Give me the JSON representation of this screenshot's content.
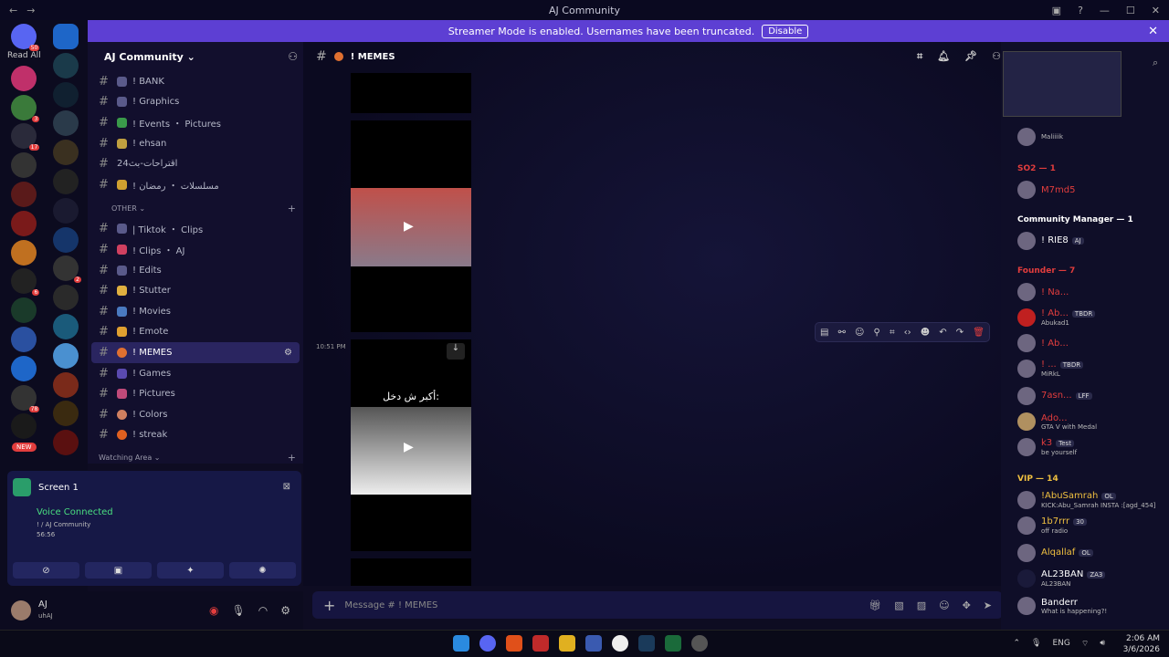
{
  "window": {
    "title": "AJ Community"
  },
  "banner": {
    "text": "Streamer Mode is enabled. Usernames have been truncated.",
    "button": "Disable"
  },
  "rail": {
    "read_all": "Read All",
    "top_badge": "50",
    "new_badge": "NEW",
    "badges": [
      "3",
      "17",
      "6",
      "78",
      "2"
    ]
  },
  "server": {
    "name": "AJ Community ⌄"
  },
  "channels": [
    {
      "name": "! BANK"
    },
    {
      "name": "! Graphics"
    },
    {
      "name": "! Events ・ Pictures"
    },
    {
      "name": "! ehsan"
    },
    {
      "name": "اقتراحات-بث24"
    },
    {
      "name": "! مسلسلات ・ رمضان"
    }
  ],
  "category_other": {
    "name": "OTHER ⌄"
  },
  "channels_other": [
    {
      "name": "| Tiktok ・ Clips"
    },
    {
      "name": "! Clips ・ AJ"
    },
    {
      "name": "! Edits"
    },
    {
      "name": "! Stutter"
    },
    {
      "name": "! Movies"
    },
    {
      "name": "! Emote"
    },
    {
      "name": "! MEMES"
    },
    {
      "name": "! Games"
    },
    {
      "name": "! Pictures"
    },
    {
      "name": "! Colors"
    },
    {
      "name": "! streak"
    }
  ],
  "category_watching": {
    "name": "Watching Area ⌄"
  },
  "voice": {
    "title": "Screen 1",
    "status": "Voice Connected",
    "channel": "! / AJ Community",
    "timer": "56:56"
  },
  "user": {
    "name": "AJ",
    "status": "uhAJ"
  },
  "main": {
    "channel": "! MEMES",
    "time": "10:51 PM",
    "overlay_text": "أكبر ش دخل:"
  },
  "composer": {
    "placeholder": "Message # ! MEMES"
  },
  "members": {
    "groups": [
      {
        "title": "SO2 — 1",
        "color": "#e23d3d"
      },
      {
        "title": "Community Manager — 1",
        "color": "#ffffff"
      },
      {
        "title": "Founder — 7",
        "color": "#e23d3d"
      },
      {
        "title": "VIP — 14",
        "color": "#f0c040"
      }
    ],
    "items": [
      {
        "name": "",
        "status": "Maliiiik",
        "color": "#e23d3d"
      },
      {
        "name": "M7md5",
        "status": "",
        "color": "#e23d3d"
      },
      {
        "name": "! RIE8",
        "status": "",
        "tag": "AJ",
        "color": "#ffffff"
      },
      {
        "name": "! Na...",
        "status": "",
        "color": "#e23d3d"
      },
      {
        "name": "! Ab...",
        "status": "Abukad1",
        "tag": "TBDR",
        "color": "#e23d3d"
      },
      {
        "name": "! Ab...",
        "status": "",
        "color": "#e23d3d"
      },
      {
        "name": "! ...",
        "status": "MiRkL",
        "tag": "TBDR",
        "color": "#e23d3d"
      },
      {
        "name": "7asn...",
        "status": "",
        "tag": "LFF",
        "color": "#e23d3d"
      },
      {
        "name": "Ado...",
        "status": "GTA V with Medal",
        "color": "#e23d3d"
      },
      {
        "name": "k3",
        "status": "be yourself",
        "tag": "Test",
        "color": "#e23d3d"
      },
      {
        "name": "!AbuSamrah",
        "status": "KICK:Abu_Samrah INSTA :[agd_454]",
        "tag": "OL",
        "color": "#f0c040"
      },
      {
        "name": "1b7rrr",
        "status": "off radio",
        "tag": "30",
        "color": "#f0c040"
      },
      {
        "name": "Alqallaf",
        "status": "",
        "tag": "OL",
        "color": "#f0c040"
      },
      {
        "name": "AL23BAN",
        "status": "AL23BAN",
        "tag": "ZA3",
        "color": "#ffffff"
      },
      {
        "name": "Banderr",
        "status": "What is happening?!",
        "color": "#ffffff"
      }
    ]
  },
  "taskbar": {
    "lang": "ENG",
    "time": "2:06 AM",
    "date": "3/6/2026"
  }
}
